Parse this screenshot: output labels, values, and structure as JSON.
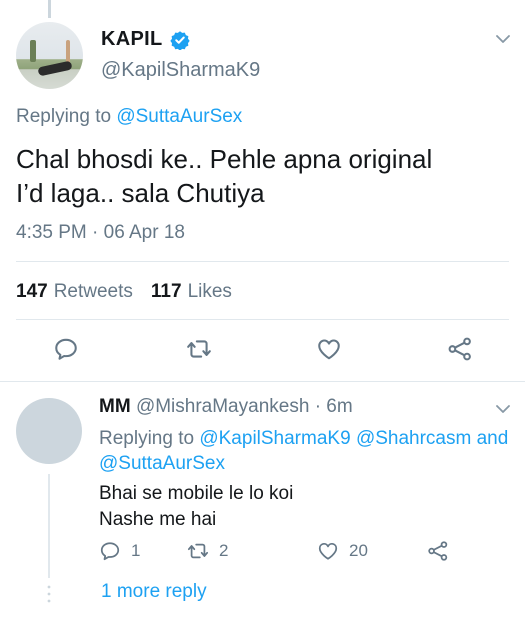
{
  "tweet": {
    "author_name": "KAPIL",
    "author_handle": "@KapilSharmaK9",
    "replying_prefix": "Replying to",
    "replying_to": "@SuttaAurSex",
    "text_line1": "Chal bhosdi ke.. Pehle apna original",
    "text_line2": "I’d laga.. sala Chutiya",
    "timestamp": "4:35 PM · 06 Apr 18",
    "retweets_count": "147",
    "retweets_label": "Retweets",
    "likes_count": "117",
    "likes_label": "Likes",
    "icons": [
      "reply-icon",
      "retweet-icon",
      "like-icon",
      "share-icon",
      "verified-badge-icon",
      "chevron-down-icon"
    ]
  },
  "reply": {
    "author_name": "MM",
    "author_handle": "@MishraMayankesh",
    "time": "· 6m",
    "replying_prefix": "Replying to",
    "replying_to_1": "@KapilSharmaK9",
    "replying_to_2": "@Shahrcasm",
    "replying_and": "and",
    "replying_to_3": "@SuttaAurSex",
    "text_line1": "Bhai se mobile le lo koi",
    "text_line2": "Nashe me hai",
    "reply_count": "1",
    "retweet_count": "2",
    "like_count": "20"
  },
  "more_replies": "1 more reply",
  "colors": {
    "link": "#1da1f2",
    "secondary_text": "#657786",
    "primary_text": "#14171a",
    "divider": "#e1e8ed",
    "avatar_placeholder": "#ccd6dd"
  }
}
